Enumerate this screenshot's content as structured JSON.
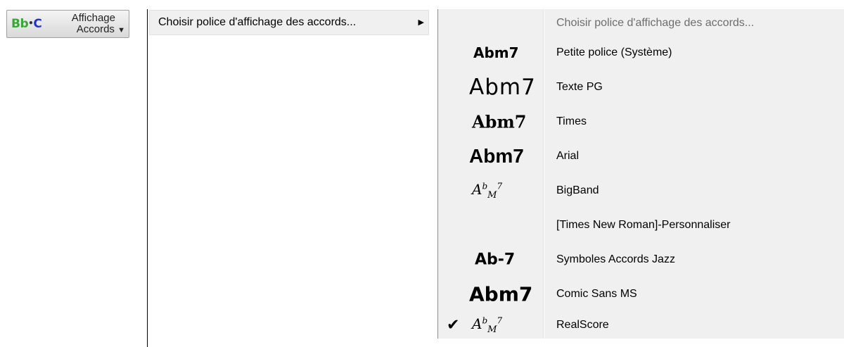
{
  "toolbar_button": {
    "icon_text_bb": "Bb",
    "icon_text_dot": "•",
    "icon_text_c": "C",
    "label_line1": "Affichage",
    "label_line2": "Accords",
    "dropdown_arrow": "▼"
  },
  "menu1": {
    "item_label": "Choisir police d'affichage des accords...",
    "submenu_arrow": "▶"
  },
  "menu2": {
    "header": "Choisir police d'affichage des accords...",
    "items": [
      {
        "label": "Petite police (Système)",
        "sample": "Abm7"
      },
      {
        "label": "Texte PG",
        "sample": "Abm7"
      },
      {
        "label": "Times",
        "sample": "Abm7"
      },
      {
        "label": "Arial",
        "sample": "Abm7"
      },
      {
        "label": "BigBand",
        "sample_a": "A",
        "sample_b": "b",
        "sample_m": "M",
        "sample_7": "7"
      },
      {
        "label": "[Times New Roman]-Personnaliser",
        "sample": ""
      },
      {
        "label": "Symboles Accords Jazz",
        "sample": "Ab-7"
      },
      {
        "label": "Comic Sans MS",
        "sample": "Abm7"
      },
      {
        "label": "RealScore",
        "sample_a": "A",
        "sample_b": "b",
        "sample_m": "M",
        "sample_7": "7",
        "checked_mark": "✔"
      }
    ]
  },
  "colors": {
    "icon_bb": "#35a835",
    "icon_c": "#2233cc",
    "menu_bg": "#f0f0f0",
    "header_text": "#6d6d6d"
  }
}
